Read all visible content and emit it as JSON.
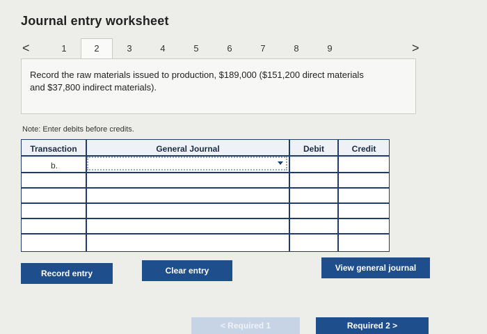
{
  "header": {
    "title": "Journal entry worksheet"
  },
  "tabs": {
    "prev_glyph": "<",
    "next_glyph": ">",
    "items": [
      "1",
      "2",
      "3",
      "4",
      "5",
      "6",
      "7",
      "8",
      "9"
    ],
    "active": "2"
  },
  "instruction": "Record the raw materials issued to production, $189,000 ($151,200 direct materials and $37,800 indirect materials).",
  "note": "Note: Enter debits before credits.",
  "table": {
    "columns": [
      "Transaction",
      "General Journal",
      "Debit",
      "Credit"
    ],
    "rows": [
      {
        "transaction": "b.",
        "account": "",
        "debit": "",
        "credit": ""
      },
      {
        "transaction": "",
        "account": "",
        "debit": "",
        "credit": ""
      },
      {
        "transaction": "",
        "account": "",
        "debit": "",
        "credit": ""
      },
      {
        "transaction": "",
        "account": "",
        "debit": "",
        "credit": ""
      },
      {
        "transaction": "",
        "account": "",
        "debit": "",
        "credit": ""
      },
      {
        "transaction": "",
        "account": "",
        "debit": "",
        "credit": ""
      }
    ]
  },
  "buttons": {
    "record": "Record entry",
    "clear": "Clear entry",
    "view": "View general journal",
    "prev": "< Required 1",
    "next": "Required 2 >"
  },
  "colors": {
    "primary": "#1f4e8c",
    "grid": "#1f3d6b",
    "background": "#ededea"
  }
}
